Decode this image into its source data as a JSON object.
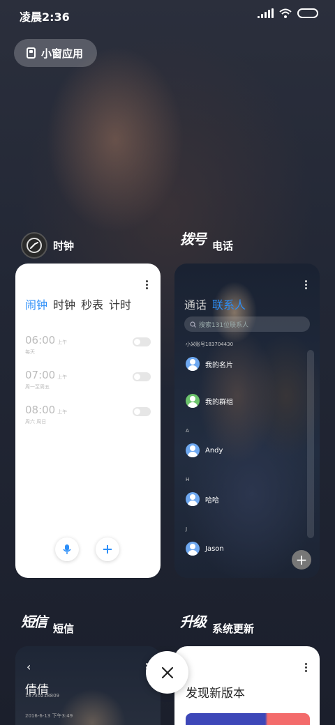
{
  "status_bar": {
    "time": "凌晨2:36"
  },
  "floating_button": {
    "label": "小窗应用"
  },
  "apps": {
    "clock": {
      "name": "时钟",
      "tabs": [
        "闹钟",
        "时钟",
        "秒表",
        "计时"
      ],
      "active_tab": 0,
      "alarms": [
        {
          "time": "06:00",
          "ampm": "上午",
          "repeat": "每天",
          "enabled": false
        },
        {
          "time": "07:00",
          "ampm": "上午",
          "repeat": "周一至周五",
          "enabled": false
        },
        {
          "time": "08:00",
          "ampm": "上午",
          "repeat": "周六 周日",
          "enabled": false
        }
      ]
    },
    "phone": {
      "name": "电话",
      "icon_text": "拨号",
      "tabs": [
        "通话",
        "联系人"
      ],
      "active_tab": 1,
      "search_placeholder": "搜索131位联系人",
      "account": "小米账号183704430",
      "contacts": [
        {
          "name": "我的名片"
        },
        {
          "name": "我的群组"
        }
      ],
      "sections": [
        {
          "letter": "A",
          "contact": "Andy"
        },
        {
          "letter": "H",
          "contact": "哈哈"
        },
        {
          "letter": "J",
          "contact": "Jason"
        }
      ],
      "fab": "+"
    },
    "sms": {
      "name": "短信",
      "icon_text": "短信",
      "contact_name": "倩倩",
      "number": "18730218809",
      "date": "2016-6-13 下午3:49"
    },
    "update": {
      "name": "系统更新",
      "icon_text": "升级",
      "title": "发现新版本"
    }
  },
  "colors": {
    "accent": "#2c8ef8",
    "update_blue": "#3d47b8",
    "update_red": "#f36b6b"
  }
}
